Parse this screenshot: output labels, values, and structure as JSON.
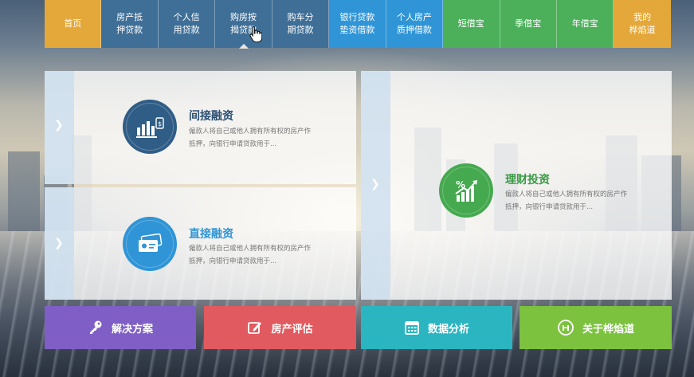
{
  "nav": {
    "items": [
      {
        "label": "首页",
        "color": "#e4a83a"
      },
      {
        "label": "房产抵\n押贷款",
        "color": "#3f6f97"
      },
      {
        "label": "个人信\n用贷款",
        "color": "#3f6f97"
      },
      {
        "label": "购房按\n揭贷款",
        "color": "#3f6f97"
      },
      {
        "label": "购车分\n期贷款",
        "color": "#3f6f97"
      },
      {
        "label": "银行贷款\n垫资借款",
        "color": "#2f95d6"
      },
      {
        "label": "个人房产\n质押借款",
        "color": "#2f95d6"
      },
      {
        "label": "短借宝",
        "color": "#4cb05b"
      },
      {
        "label": "季借宝",
        "color": "#4cb05b"
      },
      {
        "label": "年借宝",
        "color": "#4cb05b"
      },
      {
        "label": "我的\n桦焰道",
        "color": "#e4a83a"
      }
    ]
  },
  "panels": {
    "indirect": {
      "title": "间接融资",
      "desc": "僱款人将自己或他人拥有所有权的房产作抵押，向银行申请贷款用于...",
      "title_color": "#2b4f73",
      "icon": "bar-chart-money-icon",
      "icon_color": "#2f5d86"
    },
    "direct": {
      "title": "直接融资",
      "desc": "僱款人将自己或他人拥有所有权的房产作抵押，向银行申请贷款用于...",
      "title_color": "#2f95d6",
      "icon": "cash-cards-icon",
      "icon_color": "#2f95d6"
    },
    "wealth": {
      "title": "理财投资",
      "desc": "僱款人将自己或他人拥有所有权的房产作抵押，向银行申请贷款用于...",
      "title_color": "#3a9a46",
      "icon": "percent-growth-icon",
      "icon_color": "#45a94f"
    }
  },
  "buttons": [
    {
      "label": "解决方案",
      "color": "#7f5fc6",
      "icon": "key-icon"
    },
    {
      "label": "房产评估",
      "color": "#e15a5f",
      "icon": "edit-icon"
    },
    {
      "label": "数据分析",
      "color": "#2bb5c0",
      "icon": "calendar-icon"
    },
    {
      "label": "关于桦焰道",
      "color": "#7cc23f",
      "icon": "coin-icon"
    }
  ]
}
